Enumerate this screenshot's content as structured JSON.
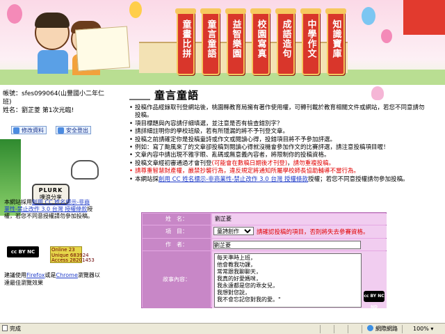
{
  "banner": {
    "nav": [
      {
        "label": "童畫比拼"
      },
      {
        "label": "童言童語"
      },
      {
        "label": "益智樂園"
      },
      {
        "label": "校園寫真"
      },
      {
        "label": "成語造句"
      },
      {
        "label": "中學作文"
      },
      {
        "label": "知識寶庫"
      }
    ]
  },
  "account": {
    "line1": "帳號：sfes099064(山豐國小二年仁班)",
    "line2": "姓名：劉芷菱 第1次光臨!",
    "edit_button": "修改資料",
    "logout_button": "安全登出"
  },
  "promo": {
    "plurk_title": "PLURK",
    "plurk_sub": "噗浪分享",
    "note_prefix": "本網站採用",
    "note_link": "創用 CC 姓名標示-非商業性-禁止改作 3.0 台灣 授權條款",
    "note_suffix": "授權，若您不同意授權請勿參加投稿。",
    "cc_label": "cc BY NC ND",
    "online": "Online 23\nUnique 683924\nAccess 28201453",
    "tip_prefix": "建議使用",
    "tip_link1": "Firefox",
    "tip_mid": "或是",
    "tip_link2": "Chrome",
    "tip_suffix": "瀏覽器以達最佳瀏覽效果"
  },
  "main": {
    "title": "童言童語",
    "rules": [
      {
        "text": "投稿作品經錄取刊登網站後，桃園縣教育局擁有著作使用權，可轉刊載於教育相關文件或網站，若您不同意請勿投稿。",
        "red": false
      },
      {
        "text": "項目標題與內容請仔細填選，並注意是否有檢查錯別字？",
        "red": false
      },
      {
        "text": "請詳細註明你的學校班級，若有所隱漏的將不予刊登文章。",
        "red": false
      },
      {
        "text": "投稿之前請確定你是投稿童詩或作文或閱讀心得，投錯項目將不予參加評選。",
        "red": false
      },
      {
        "text": "例如：寫了颱風來了的文章卻投稿到閱讀心得就沒機會參加作文的比賽評選，請注意投稿項目喔！",
        "red": false
      },
      {
        "text": "文章內容中請出現不雅字眼、亂碼或無意義內容者，將限制你的投稿資格。",
        "red": false
      },
      {
        "text_prefix": "投稿文章經初審通過才會刊登",
        "text_red1": "(可能會在數稿日期後才刊登)",
        "text_mid": "，",
        "text_red2": "請勿重複投稿。",
        "red": "mixed"
      },
      {
        "text": "請尊重智慧財產權，嚴禁抄襲行為，違反規定將通知所屬學校師長協助輔導不當行為。",
        "red": true
      },
      {
        "text_prefix": "本網站採",
        "link": "創用 CC 姓名標示-非商業性-禁止改作 3.0 台灣 授權條款",
        "text_suffix": "授權；若您不同意授權請勿參加投稿。",
        "red": "link"
      }
    ]
  },
  "form": {
    "name_label": "姓　名：",
    "name_value": "劉芷菱",
    "category_label": "項　目：",
    "category_selected": "童詩創作",
    "category_warning": "請確認投稿的項目，否則將失去參賽資格。",
    "author_label": "作　者：",
    "author_value": "劉芷菱",
    "content_label": "故事內容：",
    "content_value": "每天準時上班，\n他會教我功課，\n常常跟我聊聊天，\n我真的好愛媽咪，\n我永遠都是您的乖女兒，\n我想對您說，\n我不會忘記您對我的愛。\"",
    "cc_badge": "cc BY NC ND"
  },
  "status": {
    "left": "完成",
    "zone": "網際網路",
    "zoom": "100%"
  },
  "colors": {
    "form_bg": "#e5a8e3",
    "form_label": "#c887c7",
    "warning": "#e10000",
    "link": "#1f3cc9",
    "nav_button": "#d9362b"
  }
}
